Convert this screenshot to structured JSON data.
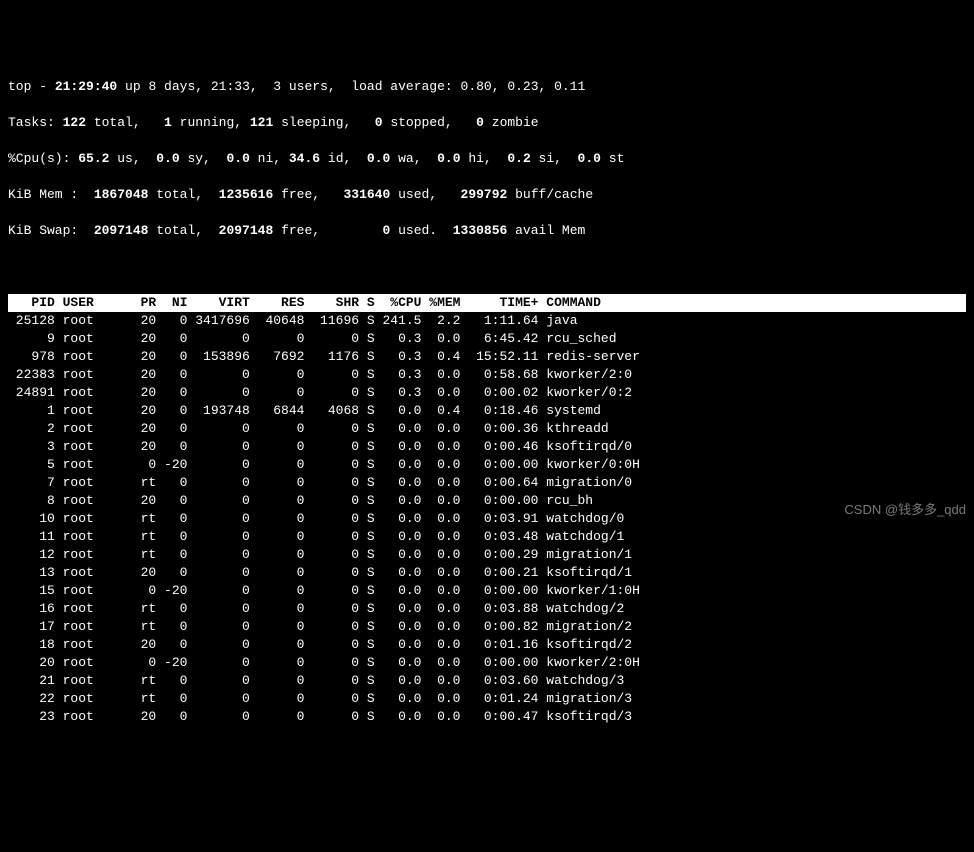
{
  "summary": {
    "line1_prefix": "top - ",
    "time": "21:29:40",
    "up_label": " up ",
    "uptime": "8 days, 21:33,",
    "users": "  3 users,",
    "load_label": "  load average: ",
    "load": "0.80, 0.23, 0.11",
    "tasks_label": "Tasks:",
    "tasks_total": " 122 ",
    "tasks_total_lbl": "total,",
    "tasks_run": "   1 ",
    "tasks_run_lbl": "running,",
    "tasks_sleep": " 121 ",
    "tasks_sleep_lbl": "sleeping,",
    "tasks_stop": "   0 ",
    "tasks_stop_lbl": "stopped,",
    "tasks_zomb": "   0 ",
    "tasks_zomb_lbl": "zombie",
    "cpu_label": "%Cpu(s):",
    "cpu_us": " 65.2 ",
    "cpu_us_lbl": "us,",
    "cpu_sy": "  0.0 ",
    "cpu_sy_lbl": "sy,",
    "cpu_ni": "  0.0 ",
    "cpu_ni_lbl": "ni,",
    "cpu_id": " 34.6 ",
    "cpu_id_lbl": "id,",
    "cpu_wa": "  0.0 ",
    "cpu_wa_lbl": "wa,",
    "cpu_hi": "  0.0 ",
    "cpu_hi_lbl": "hi,",
    "cpu_si": "  0.2 ",
    "cpu_si_lbl": "si,",
    "cpu_st": "  0.0 ",
    "cpu_st_lbl": "st",
    "mem_label": "KiB Mem :",
    "mem_total": "  1867048 ",
    "mem_total_lbl": "total,",
    "mem_free": "  1235616 ",
    "mem_free_lbl": "free,",
    "mem_used": "   331640 ",
    "mem_used_lbl": "used,",
    "mem_buff": "   299792 ",
    "mem_buff_lbl": "buff/cache",
    "swap_label": "KiB Swap:",
    "swap_total": "  2097148 ",
    "swap_total_lbl": "total,",
    "swap_free": "  2097148 ",
    "swap_free_lbl": "free,",
    "swap_used": "        0 ",
    "swap_used_lbl": "used.",
    "swap_avail": "  1330856 ",
    "swap_avail_lbl": "avail Mem"
  },
  "columns": "   PID USER      PR  NI    VIRT    RES    SHR S  %CPU %MEM     TIME+ COMMAND                                       ",
  "rows": [
    " 25128 root      20   0 3417696  40648  11696 S 241.5  2.2   1:11.64 java",
    "     9 root      20   0       0      0      0 S   0.3  0.0   6:45.42 rcu_sched",
    "   978 root      20   0  153896   7692   1176 S   0.3  0.4  15:52.11 redis-server",
    " 22383 root      20   0       0      0      0 S   0.3  0.0   0:58.68 kworker/2:0",
    " 24891 root      20   0       0      0      0 S   0.3  0.0   0:00.02 kworker/0:2",
    "     1 root      20   0  193748   6844   4068 S   0.0  0.4   0:18.46 systemd",
    "     2 root      20   0       0      0      0 S   0.0  0.0   0:00.36 kthreadd",
    "     3 root      20   0       0      0      0 S   0.0  0.0   0:00.46 ksoftirqd/0",
    "     5 root       0 -20       0      0      0 S   0.0  0.0   0:00.00 kworker/0:0H",
    "     7 root      rt   0       0      0      0 S   0.0  0.0   0:00.64 migration/0",
    "     8 root      20   0       0      0      0 S   0.0  0.0   0:00.00 rcu_bh",
    "    10 root      rt   0       0      0      0 S   0.0  0.0   0:03.91 watchdog/0",
    "    11 root      rt   0       0      0      0 S   0.0  0.0   0:03.48 watchdog/1",
    "    12 root      rt   0       0      0      0 S   0.0  0.0   0:00.29 migration/1",
    "    13 root      20   0       0      0      0 S   0.0  0.0   0:00.21 ksoftirqd/1",
    "    15 root       0 -20       0      0      0 S   0.0  0.0   0:00.00 kworker/1:0H",
    "    16 root      rt   0       0      0      0 S   0.0  0.0   0:03.88 watchdog/2",
    "    17 root      rt   0       0      0      0 S   0.0  0.0   0:00.82 migration/2",
    "    18 root      20   0       0      0      0 S   0.0  0.0   0:01.16 ksoftirqd/2",
    "    20 root       0 -20       0      0      0 S   0.0  0.0   0:00.00 kworker/2:0H",
    "    21 root      rt   0       0      0      0 S   0.0  0.0   0:03.60 watchdog/3",
    "    22 root      rt   0       0      0      0 S   0.0  0.0   0:01.24 migration/3",
    "    23 root      20   0       0      0      0 S   0.0  0.0   0:00.47 ksoftirqd/3"
  ],
  "watermark": "CSDN @钱多多_qdd"
}
